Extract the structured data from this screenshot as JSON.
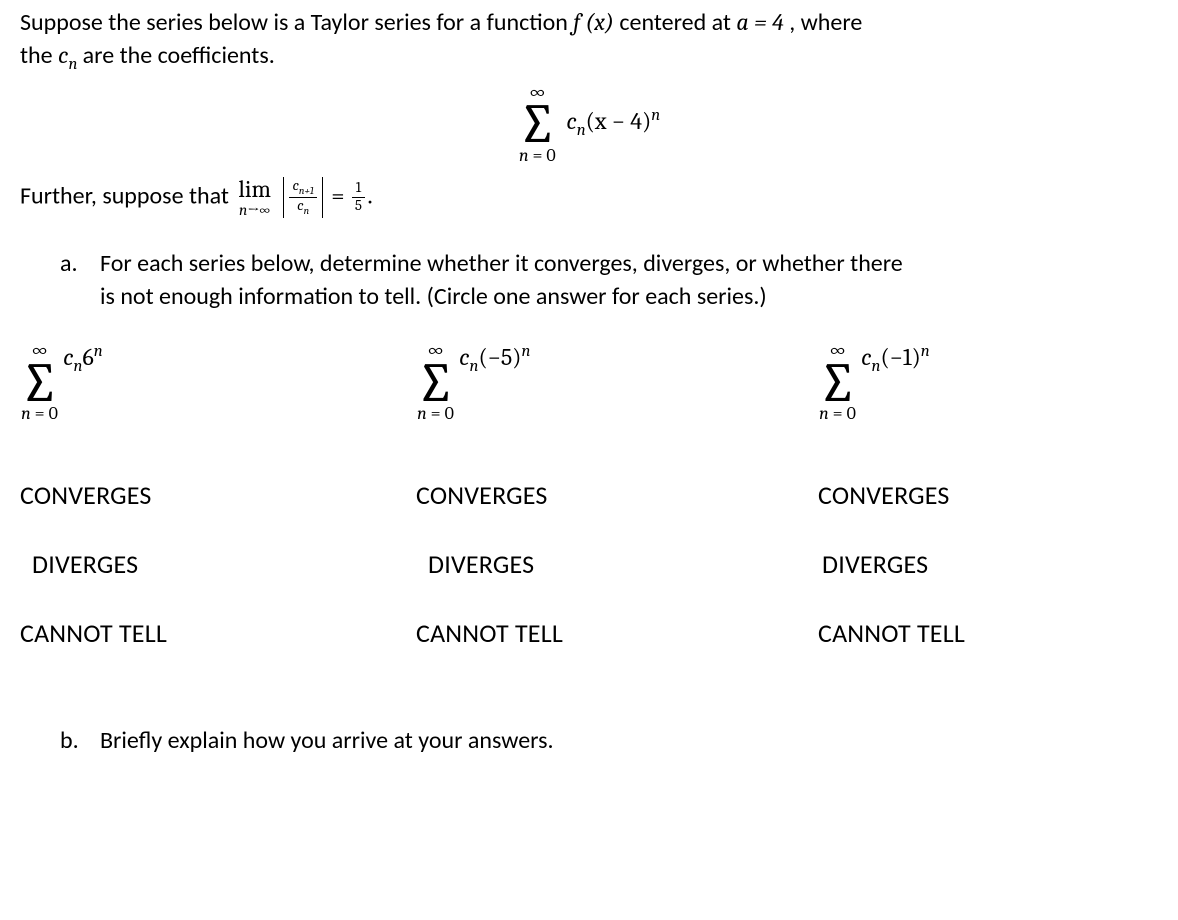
{
  "intro": {
    "line1_pre": "Suppose the series below is a Taylor series for a function ",
    "fx": "f (x)",
    "line1_mid": " centered at ",
    "a_eq": "a = 4",
    "line1_post": ", where",
    "line2_pre": "the ",
    "cn": "c",
    "cn_sub": "n",
    "line2_post": " are the coefficients."
  },
  "main_series": {
    "top": "∞",
    "bot_lhs": "n",
    "bot_eq": " = 0",
    "coef": "c",
    "coef_sub": "n",
    "paren": "(x − 4)",
    "exp": "n"
  },
  "ratio_line": {
    "pre": "Further, suppose that ",
    "lim": "lim",
    "lim_sub": "n→∞",
    "num": "c",
    "num_sub": "n+1",
    "den": "c",
    "den_sub": "n",
    "eq": " = ",
    "frac_num": "1",
    "frac_den": "5",
    "period": "."
  },
  "part_a": {
    "marker": "a.",
    "text1": "For each series below, determine whether it converges, diverges, or whether there",
    "text2": "is not enough information to tell.  (Circle one answer for each series.)"
  },
  "series_cols": [
    {
      "top": "∞",
      "bot_lhs": "n",
      "bot_eq": " = 0",
      "coef": "c",
      "coef_sub": "n",
      "base": "6",
      "exp": "n"
    },
    {
      "top": "∞",
      "bot_lhs": "n",
      "bot_eq": " = 0",
      "coef": "c",
      "coef_sub": "n",
      "base": "(−5)",
      "exp": "n"
    },
    {
      "top": "∞",
      "bot_lhs": "n",
      "bot_eq": " = 0",
      "coef": "c",
      "coef_sub": "n",
      "base": "(−1)",
      "exp": "n"
    }
  ],
  "options": {
    "converges": "CONVERGES",
    "diverges": "DIVERGES",
    "cannot": "CANNOT TELL"
  },
  "part_b": {
    "marker": "b.",
    "text": "Briefly explain how you arrive at your answers."
  }
}
